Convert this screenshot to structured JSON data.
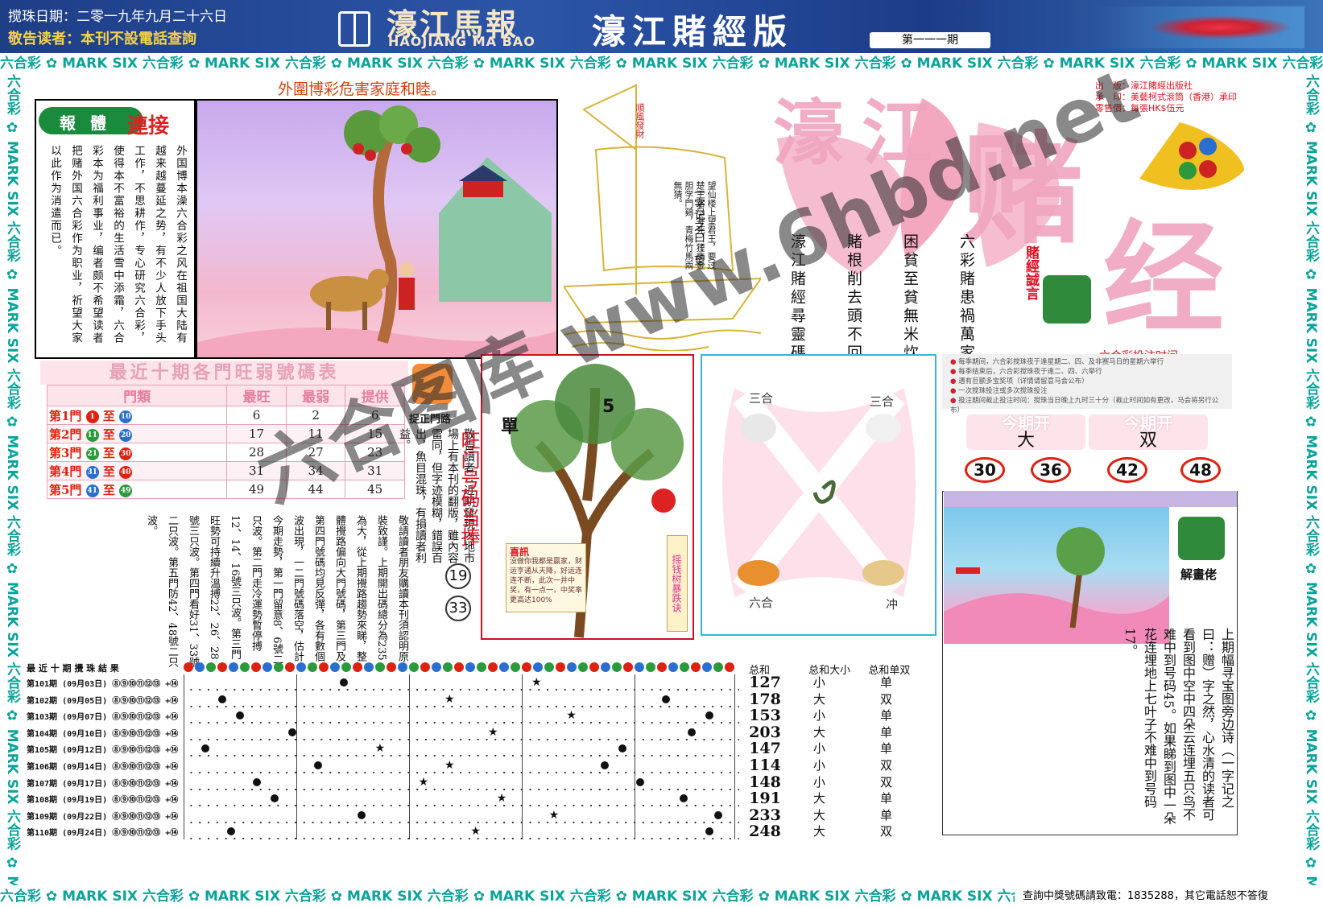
{
  "header": {
    "draw_date": "搅珠日期：二零一九年九月二十六日",
    "reader_notice": "敬告读者：本刊不設電話查詢",
    "paper_name": "濠江馬報",
    "paper_name_en": "HAOJIANG MA BAO",
    "edition_title": "濠江賭經版",
    "issue_no": "第一一一期"
  },
  "border_band_text": "六合彩 ✿ MARK SIX 六合彩 ✿ MARK SIX 六合彩 ✿ MARK SIX 六合彩 ✿ MARK SIX 六合彩 ✿ MARK SIX 六合彩 ✿ MARK SIX 六合彩 ✿ MARK SIX 六合彩 ✿ MARK SIX 六合彩 ✿ MARK SIX 六合彩 ✿ MARK SIX",
  "bottom_contact": "查詢中獎號碼請致電：1835288，其它電話恕不答復",
  "report": {
    "slogan": "外圍博彩危害家庭和睦。",
    "tag_a": "報",
    "tag_b": "體",
    "title_b": "連接",
    "body": "外国博本澡六合彩之风在祖国大陆有越来越蔓延之势，有不少人放下手头工作，不思耕作，专心研究六合彩，使得本不富裕的生活雪中添霜，六合彩本为福利事业，编者颇不希望读者把赌外国六合彩作为职业，祈望大家以此作为消遣而已。"
  },
  "boat": {
    "flag_text": "順風發財",
    "heading": "一字记之曰：望",
    "poem": "望仙楼上望君王，要过楚王路尽寻死，狸高金胆学門鷄，青梅竹馬兩無猜。"
  },
  "masthead": {
    "char_1": "濠",
    "char_2": "江",
    "char_3": "赌",
    "char_4": "经",
    "pub_publisher": "出　版：濠江賭經出版社",
    "pub_printer": "承　印：美藝柯式滾筒（香港）承印",
    "pub_price": "零售價：每張HK$伍元",
    "couplet_1": "六彩賭患禍萬家",
    "couplet_2": "困貧至貧無米炊",
    "couplet_3": "賭根削去頭不回",
    "couplet_4": "濠江賭經尋靈碼",
    "motto": "賭經誠言"
  },
  "hot_table": {
    "title": "最近十期各門旺弱號碼表",
    "headers": [
      "門類",
      "最旺",
      "最弱",
      "提供"
    ],
    "rows": [
      {
        "door": "第1門",
        "from": "1",
        "to": "10",
        "from_color": "#d21",
        "to_color": "#2a6fd0",
        "hot": "6",
        "cold": "2",
        "offer": "6"
      },
      {
        "door": "第2門",
        "from": "11",
        "to": "20",
        "from_color": "#2a9a3c",
        "to_color": "#2a6fd0",
        "hot": "17",
        "cold": "11",
        "offer": "15"
      },
      {
        "door": "第3門",
        "from": "21",
        "to": "30",
        "from_color": "#2a9a3c",
        "to_color": "#d21",
        "hot": "28",
        "cold": "27",
        "offer": "23"
      },
      {
        "door": "第4門",
        "from": "31",
        "to": "40",
        "from_color": "#2a6fd0",
        "to_color": "#d21",
        "hot": "31",
        "cold": "34",
        "offer": "31"
      },
      {
        "door": "第5門",
        "from": "41",
        "to": "49",
        "from_color": "#2a6fd0",
        "to_color": "#2a9a3c",
        "hot": "49",
        "cold": "44",
        "offer": "45"
      }
    ],
    "range_sep": "至"
  },
  "correct_label": "捉正門路",
  "notice_text": "敬告讀者：近期發現內地市場上有本刊的翻版，雖內容雷同，但字迹模糊，錯誤百出，魚目混珠，有損讀者利益。",
  "hot_door": {
    "title": "旺门号码当捧",
    "num_1": "19",
    "num_2": "33"
  },
  "long_text": "敬請讀者朋友購讀本刊須認明原裝致謹。上期開出碼總分為235為大，從上期攪路趨勢來睇，整體攪路偏向大門號碼，第三門及第四門號碼均見反彈，各有數個波出現，一二門號碼落空，估計今期走勢，第一門留意8、6號二只波。第二門走冷運勢暫停搏12、14、16號三只波。第三門旺勢可持續升溫搏22、26、28號三只波。第四門看好31、33號二只波。第五門防42、48號二只波。",
  "tree": {
    "single": "單",
    "five": "5",
    "joy_title": "喜訊",
    "joy_text": "没做你我都是赢家，财运亨通从天降，好运连连不断，此次一并中奖，有一点一，中奖率更高达100%",
    "label": "摇钱树暴跌诀"
  },
  "zodiac": {
    "tl": "三合",
    "tr": "三合",
    "bl": "六合",
    "br": "冲"
  },
  "bet_time_title": "六合彩投注时间",
  "rules": [
    "每季期间，六合彩搅珠夜于逢星期二、四、及非赛马日的星期六举行",
    "每季结束后，六合彩搅珠夜于逢二、四、六举行",
    "遇有巨额多宝奖项（详情请留意马会公布）",
    "一次搅珠投注或多次搅珠投注",
    "投注期间截止投注时间：搅珠当日晚上九时三十分（截止时间如有更改，马会将另行公布）"
  ],
  "today": {
    "label": "今期开",
    "big_small": "大",
    "odd_even": "双"
  },
  "lucky_nums": [
    "30",
    "36",
    "42",
    "48"
  ],
  "rebus": {
    "decode_label": "解畫佬",
    "text": "上期幅寻宝图旁边诗（一字记之曰：赠）字之然，心水清的读者可看到图中空中四朵云连埋五只鸟不难中到号码45。如果睇到图中一朵花连埋地上七叶子不难中到号码17。"
  },
  "results": {
    "title": "最 近 十 期 攪 珠 結 果",
    "sum_header": "总和",
    "size_header": "总和大小",
    "parity_header": "总和单双",
    "ball_colors": [
      "#d21",
      "#2a6fd0",
      "#2a9a3c"
    ],
    "rows": [
      {
        "label": "第101期 (09月03日) ⑧⑨⑩⑪⑫⑬ +⑭",
        "sum": "127",
        "size": "小",
        "parity": "单"
      },
      {
        "label": "第102期 (09月05日) ⑧⑨⑩⑪⑫⑬ +⑭",
        "sum": "178",
        "size": "大",
        "parity": "双"
      },
      {
        "label": "第103期 (09月07日) ⑧⑨⑩⑪⑫⑬ +⑭",
        "sum": "153",
        "size": "小",
        "parity": "单"
      },
      {
        "label": "第104期 (09月10日) ⑧⑨⑩⑪⑫⑬ +⑭",
        "sum": "203",
        "size": "大",
        "parity": "单"
      },
      {
        "label": "第105期 (09月12日) ⑧⑨⑩⑪⑫⑬ +⑭",
        "sum": "147",
        "size": "小",
        "parity": "单"
      },
      {
        "label": "第106期 (09月14日) ⑧⑨⑩⑪⑫⑬ +⑭",
        "sum": "114",
        "size": "小",
        "parity": "双"
      },
      {
        "label": "第107期 (09月17日) ⑧⑨⑩⑪⑫⑬ +⑭",
        "sum": "148",
        "size": "小",
        "parity": "双"
      },
      {
        "label": "第108期 (09月19日) ⑧⑨⑩⑪⑫⑬ +⑭",
        "sum": "191",
        "size": "大",
        "parity": "单"
      },
      {
        "label": "第109期 (09月22日) ⑧⑨⑩⑪⑫⑬ +⑭",
        "sum": "233",
        "size": "大",
        "parity": "单"
      },
      {
        "label": "第110期 (09月24日) ⑧⑨⑩⑪⑫⑬ +⑭",
        "sum": "248",
        "size": "大",
        "parity": "双"
      }
    ]
  },
  "watermark": "六合图库 www.6hbd.net"
}
